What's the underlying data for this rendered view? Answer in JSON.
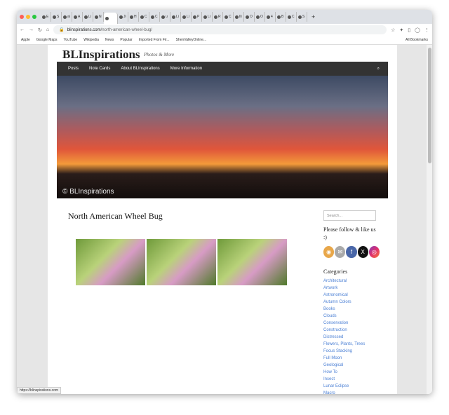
{
  "browser": {
    "tabs": [
      "E",
      "S",
      "ai",
      "A",
      "Li",
      "N",
      "",
      "Ji",
      "H",
      "C",
      "C",
      "u",
      "Li",
      "Li",
      "P",
      "Li",
      "R",
      "C",
      "Ili",
      "O",
      "O",
      "4",
      "B",
      "C",
      "S"
    ],
    "active_tab_index": 6,
    "url_domain": "blinspirations.com",
    "url_path": "/north-american-wheel-bug/",
    "bookmarks": [
      "Apple",
      "Google Maps",
      "YouTube",
      "Wikipedia",
      "News",
      "Popular",
      "Imported From Fir...",
      "ShenValleyOnline..."
    ],
    "all_bookmarks": "All Bookmarks",
    "status_url": "https://blinspirations.com"
  },
  "site": {
    "title": "BLInspirations",
    "tagline": "Photos & More",
    "nav": [
      "Posts",
      "Note Cards",
      "About BLInspirations",
      "More Information"
    ],
    "hero_caption": "© BLInspirations"
  },
  "post": {
    "title": "North American Wheel Bug"
  },
  "sidebar": {
    "search_placeholder": "Search...",
    "follow_heading": "Please follow & like us :)",
    "social": [
      "rss",
      "email",
      "facebook",
      "x",
      "instagram"
    ],
    "categories_heading": "Categories",
    "categories": [
      "Architectural",
      "Artwork",
      "Astronomical",
      "Autumn Colors",
      "Books",
      "Clouds",
      "Conservation",
      "Construction",
      "Distressed",
      "Flowers, Plants, Trees",
      "Focus Stacking",
      "Full Moon",
      "Geological",
      "How To",
      "Insect",
      "Lunar Eclipse",
      "Macro"
    ]
  }
}
